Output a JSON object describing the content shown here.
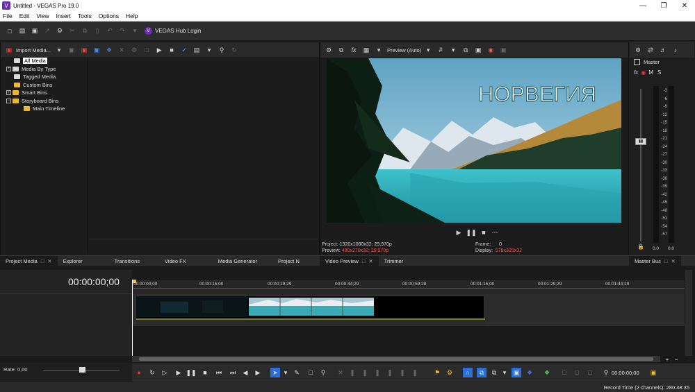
{
  "window": {
    "title": "Untitled - VEGAS Pro 19.0",
    "app_icon": "V"
  },
  "menu": [
    "File",
    "Edit",
    "View",
    "Insert",
    "Tools",
    "Options",
    "Help"
  ],
  "main_toolbar": {
    "hub_label": "VEGAS Hub Login"
  },
  "project_media": {
    "import_label": "Import Media...",
    "tree": [
      {
        "label": "All Media",
        "selected": true
      },
      {
        "label": "Media By Type"
      },
      {
        "label": "Tagged Media"
      },
      {
        "label": "Custom Bins"
      },
      {
        "label": "Smart Bins"
      },
      {
        "label": "Storyboard Bins"
      },
      {
        "label": "Main Timeline"
      }
    ]
  },
  "left_tabs": [
    "Project Media",
    "Explorer",
    "Transitions",
    "Video FX",
    "Media Generator",
    "Project N"
  ],
  "preview": {
    "mode": "Preview (Auto)",
    "overlay_text": "НОРВЕГИЯ",
    "project_label": "Project:",
    "project_value": "1920x1080x32; 29,970p",
    "preview_label": "Preview:",
    "preview_value": "480x270x32; 29,970p",
    "frame_label": "Frame:",
    "frame_value": "0",
    "display_label": "Display:",
    "display_value": "578x325x32"
  },
  "preview_tabs": [
    "Video Preview",
    "Trimmer"
  ],
  "master": {
    "label": "Master",
    "fx": "fx",
    "m": "M",
    "s": "S",
    "tab": "Master Bus",
    "scale": [
      "3",
      "6",
      "9",
      "12",
      "15",
      "18",
      "21",
      "24",
      "27",
      "30",
      "33",
      "36",
      "39",
      "42",
      "45",
      "48",
      "51",
      "54",
      "57"
    ],
    "bottom_left": "0.0",
    "bottom_right": "0.0"
  },
  "timeline": {
    "timecode": "00:00:00;00",
    "ruler": [
      "00:00:00;00",
      "00:00:15;00",
      "00:00:29;29",
      "00:00:44;29",
      "00:00:59;28",
      "00:01:15;00",
      "00:01:29;29",
      "00:01:44;29"
    ],
    "rate": "Rate: 0,00"
  },
  "transport": {
    "end_time": "00:00:00;00"
  },
  "status": {
    "text": "Record Time (2 channels): 280:48:35"
  },
  "colors": {
    "accent": "#6a2fb3",
    "record": "#e03a3a",
    "selected_tool": "#2a6fd6"
  }
}
